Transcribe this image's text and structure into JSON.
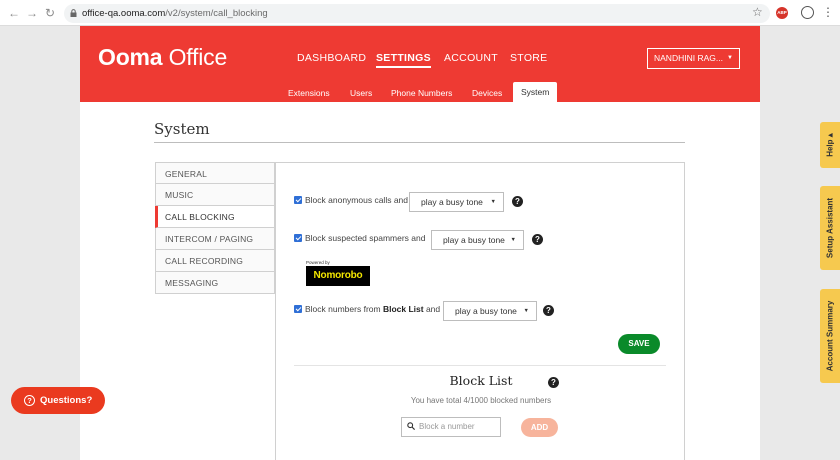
{
  "browser": {
    "url_host": "office-qa.ooma.com",
    "url_path": "/v2/system/call_blocking",
    "adblock_label": "ABP"
  },
  "header": {
    "logo_brand": "Ooma",
    "logo_product": "Office",
    "nav": [
      "DASHBOARD",
      "SETTINGS",
      "ACCOUNT",
      "STORE"
    ],
    "active_nav": "SETTINGS",
    "user_label": "NANDHINI RAG...",
    "subnav": [
      "Extensions",
      "Users",
      "Phone Numbers",
      "Devices",
      "System"
    ],
    "active_subnav": "System"
  },
  "page_title": "System",
  "sidemenu": [
    "GENERAL",
    "MUSIC",
    "CALL BLOCKING",
    "INTERCOM / PAGING",
    "CALL RECORDING",
    "MESSAGING"
  ],
  "active_sidemenu": "CALL BLOCKING",
  "settings": {
    "anonymous": {
      "label": "Block anonymous calls and",
      "checked": true,
      "option": "play a busy tone"
    },
    "spammers": {
      "label": "Block suspected spammers and",
      "checked": true,
      "option": "play a busy tone"
    },
    "powered_by": "Powered by",
    "nomorobo": "Nomorobo",
    "blocklist": {
      "label_pre": "Block numbers from ",
      "label_bold": "Block List",
      "label_post": " and",
      "checked": true,
      "option": "play a busy tone"
    },
    "save_label": "SAVE",
    "help_glyph": "?"
  },
  "block_list": {
    "title": "Block List",
    "count_text": "You have total 4/1000 blocked numbers",
    "search_placeholder": "Block a number",
    "add_label": "ADD"
  },
  "right_tabs": [
    "Help ▴",
    "Setup Assistant",
    "Account Summary"
  ],
  "questions_label": "Questions?",
  "colors": {
    "brand_red": "#ee3a33",
    "save_green": "#0a8a2a",
    "tab_yellow": "#f6c94f",
    "checkbox_blue": "#2f6fd6"
  }
}
